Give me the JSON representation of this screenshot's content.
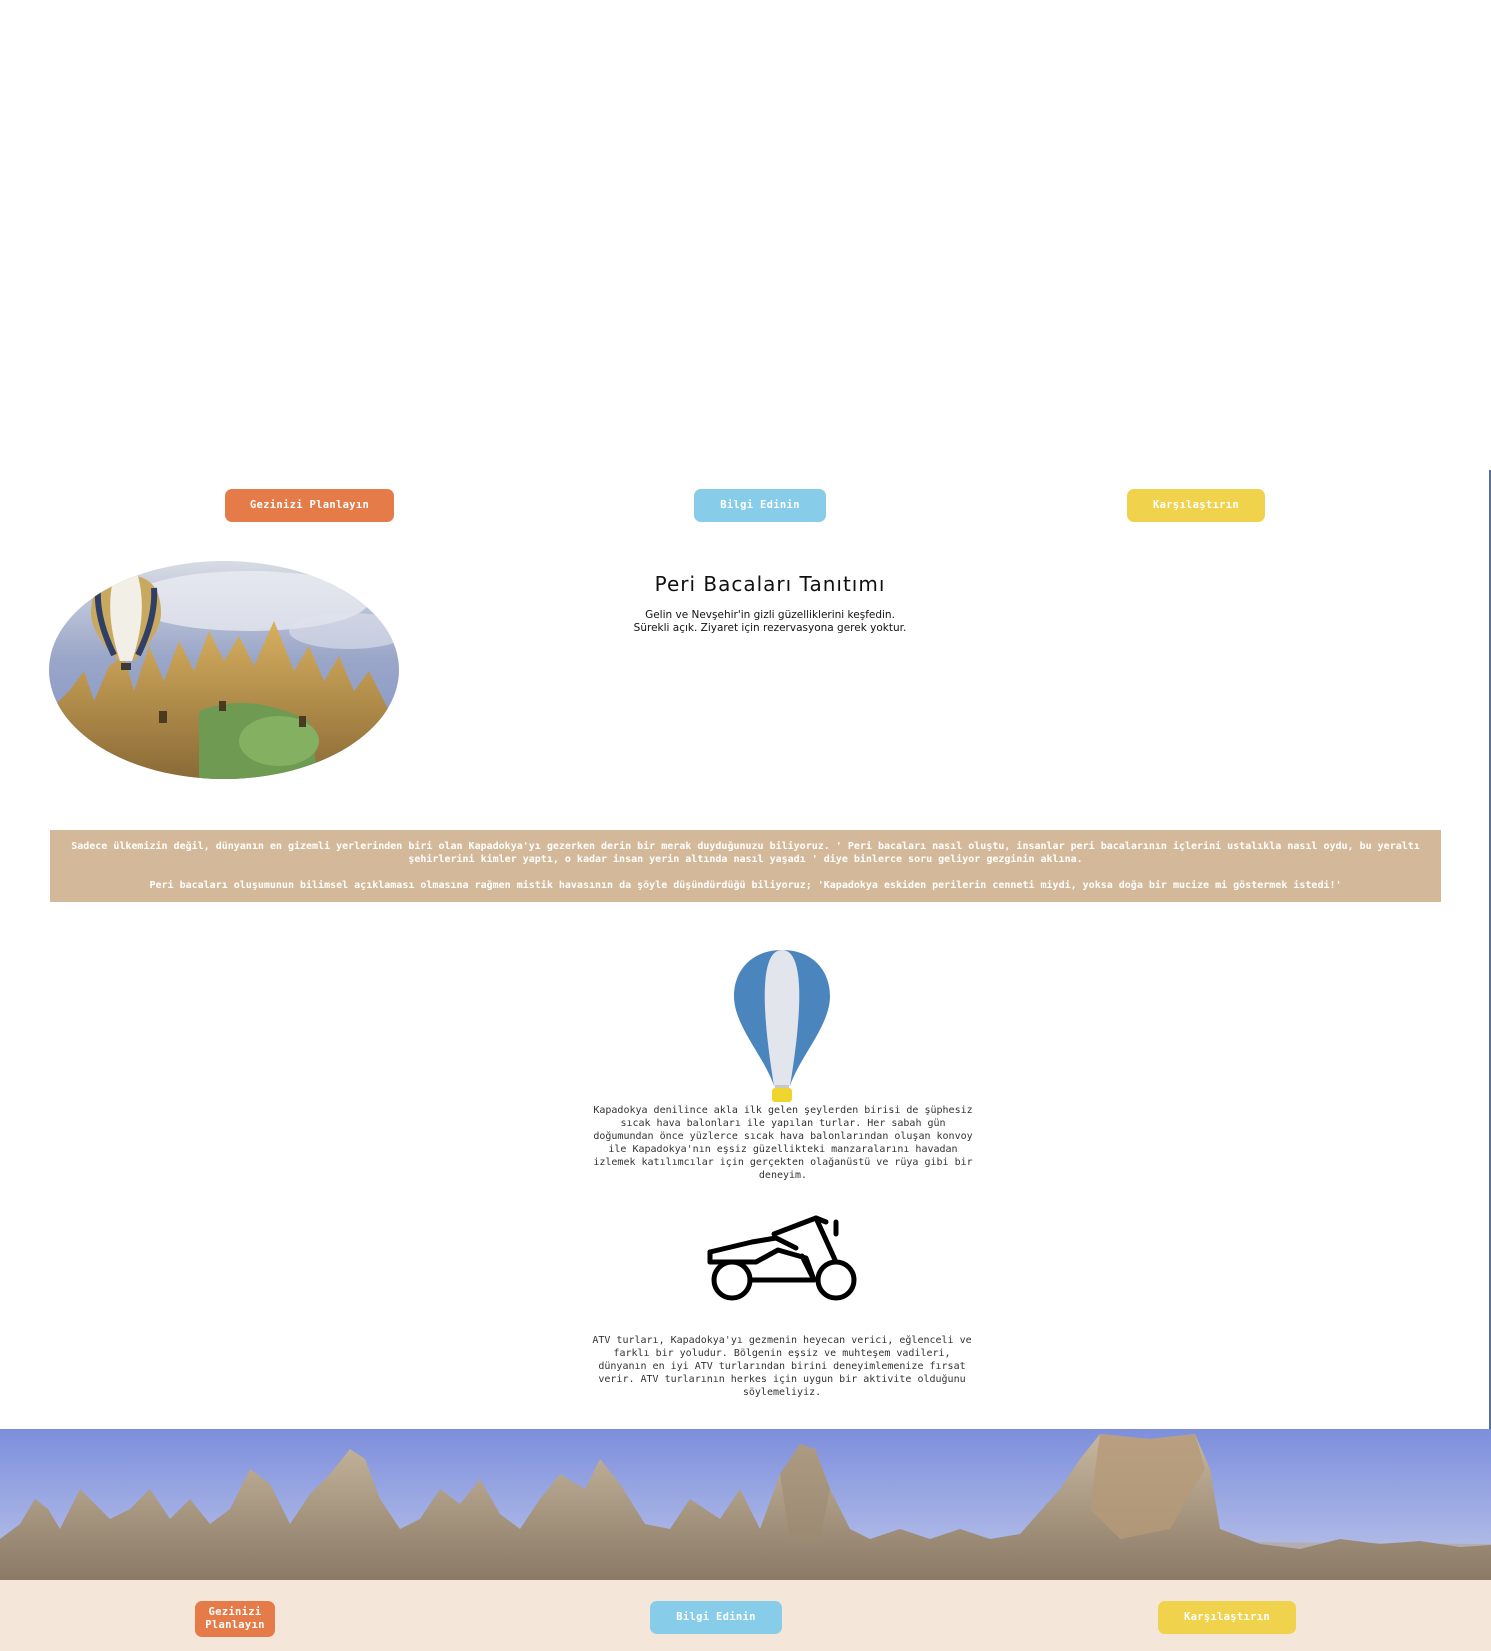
{
  "nav_top": {
    "plan_label": "Gezinizi Planlayın",
    "info_label": "Bilgi Edinin",
    "compare_label": "Karşılaştırın"
  },
  "intro": {
    "title": "Peri Bacaları Tanıtımı",
    "subtitle_line1": "Gelin ve Nevşehir'in gizli güzelliklerini keşfedin.",
    "subtitle_line2": "Sürekli açık. Ziyaret için rezervasyona gerek yoktur."
  },
  "banner": {
    "paragraph1": "Sadece ülkemizin değil, dünyanın en gizemli yerlerinden biri olan Kapadokya'yı gezerken derin bir merak duyduğunuzu biliyoruz. ' Peri bacaları nasıl oluştu, insanlar peri bacalarının içlerini ustalıkla nasıl oydu, bu yeraltı şehirlerini kimler yaptı, o kadar insan yerin altında nasıl yaşadı ' diye binlerce soru geliyor gezginin aklına.",
    "paragraph2": "Peri bacaları oluşumunun bilimsel açıklaması olmasına rağmen mistik havasının da şöyle düşündürdüğü biliyoruz; 'Kapadokya eskiden perilerin cenneti miydi, yoksa doğa bir mucize mi göstermek istedi!'"
  },
  "features": {
    "balloon_icon": "hot-air-balloon-icon",
    "balloon_text": "Kapadokya denilince akla ilk gelen şeylerden birisi de şüphesiz sıcak hava balonları ile yapılan turlar. Her sabah gün doğumundan önce yüzlerce sıcak hava balonlarından oluşan konvoy ile Kapadokya'nın eşsiz güzellikteki manzaralarını havadan izlemek katılımcılar için gerçekten olağanüstü ve rüya gibi bir deneyim.",
    "atv_icon": "atv-icon",
    "atv_text": "ATV turları, Kapadokya'yı gezmenin heyecan verici, eğlenceli ve farklı bir yoludur. Bölgenin eşsiz ve muhteşem vadileri, dünyanın en iyi ATV turlarından birini deneyimlemenize fırsat verir. ATV turlarının herkes için uygun bir aktivite olduğunu söylemeliyiz."
  },
  "nav_footer": {
    "plan_label": "Gezinizi Planlayın",
    "info_label": "Bilgi Edinin",
    "compare_label": "Karşılaştırın"
  },
  "colors": {
    "orange": "#e57b48",
    "blue": "#87cce8",
    "yellow": "#f1d24d",
    "banner": "#d3b999",
    "footer": "#f4e7d9",
    "balloon_blue": "#4a86bd"
  }
}
